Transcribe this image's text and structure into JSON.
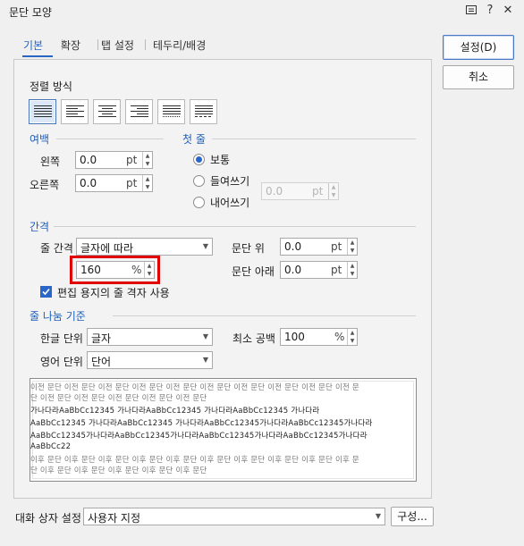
{
  "window": {
    "title": "문단 모양"
  },
  "titlebar_icons": [
    "chat-icon",
    "help-icon",
    "close-icon"
  ],
  "titlebar_glyphs": {
    "help": "?",
    "close": "✕"
  },
  "tabs": [
    {
      "label": "기본",
      "active": true
    },
    {
      "label": "확장",
      "active": false
    },
    {
      "label": "탭 설정",
      "active": false
    },
    {
      "label": "테두리/배경",
      "active": false
    }
  ],
  "buttons": {
    "ok": "설정(D)",
    "cancel": "취소",
    "compose": "구성..."
  },
  "alignment": {
    "title": "정렬 방식",
    "options": [
      "justify",
      "left",
      "center",
      "right",
      "distribute",
      "divide"
    ],
    "selected": "justify"
  },
  "margin": {
    "title": "여백",
    "left_label": "왼쪽",
    "left_value": "0.0",
    "left_unit": "pt",
    "right_label": "오른쪽",
    "right_value": "0.0",
    "right_unit": "pt"
  },
  "first_line": {
    "title": "첫 줄",
    "options": [
      "보통",
      "들여쓰기",
      "내어쓰기"
    ],
    "selected": "보통",
    "indent_value": "0.0",
    "indent_unit": "pt"
  },
  "spacing": {
    "title": "간격",
    "line_spacing_label": "줄 간격",
    "line_spacing_type": "글자에 따라",
    "line_spacing_value": "160",
    "line_spacing_unit": "%",
    "before_label": "문단 위",
    "before_value": "0.0",
    "before_unit": "pt",
    "after_label": "문단 아래",
    "after_value": "0.0",
    "after_unit": "pt",
    "grid_checkbox_label": "편집 용지의 줄 격자 사용",
    "grid_checked": true
  },
  "line_break": {
    "title": "줄 나눔 기준",
    "korean_label": "한글 단위",
    "korean_value": "글자",
    "english_label": "영어 단위",
    "english_value": "단어",
    "min_space_label": "최소 공백",
    "min_space_value": "100",
    "min_space_unit": "%"
  },
  "preview": {
    "lines": [
      "이전 문단 이전 문단 이전 문단 이전 문단 이전 문단 이전 문단 이전 문단 이전 문단 이전 문단 이전 문",
      "단 이전 문단 이전 문단 이전 문단 이전 문단 이전 문단",
      "가나다라AaBbCc12345      가나다라AaBbCc12345      가나다라AaBbCc12345      가나다라",
      "AaBbCc12345  가나다라AaBbCc12345  가나다라AaBbCc12345가나다라AaBbCc12345가나다라",
      "AaBbCc12345가나다라AaBbCc12345가나다라AaBbCc12345가나다라AaBbCc12345가나다라",
      "AaBbCc22",
      "이후 문단 이후 문단 이후 문단 이후 문단 이후 문단 이후 문단 이후 문단 이후 문단 이후 문단 이후 문",
      "단 이후 문단 이후 문단 이후 문단 이후 문단 이후 문단"
    ]
  },
  "dialog_setting": {
    "label": "대화 상자 설정",
    "value": "사용자 지정"
  },
  "colors": {
    "accent": "#2a66c9",
    "section_title": "#1f5fb9",
    "highlight": "#e00000"
  }
}
